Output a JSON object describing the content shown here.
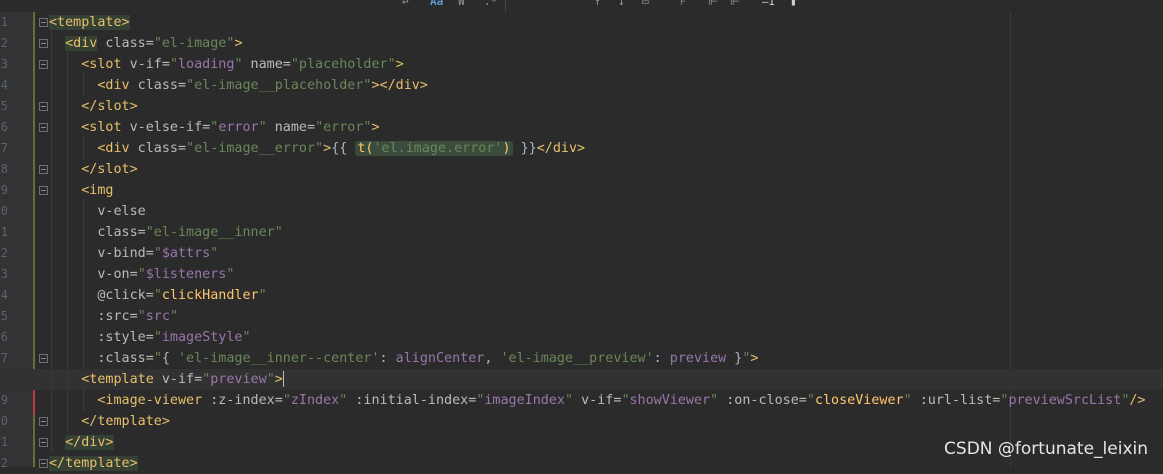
{
  "editor": {
    "language": "vue-template",
    "current_line_index": 17,
    "lines": [
      {
        "num": "1",
        "indent": 0,
        "fold": true
      },
      {
        "num": "2",
        "indent": 1,
        "fold": true
      },
      {
        "num": "3",
        "indent": 2,
        "fold": true
      },
      {
        "num": "4",
        "indent": 3,
        "fold": false
      },
      {
        "num": "5",
        "indent": 2,
        "fold": true
      },
      {
        "num": "6",
        "indent": 2,
        "fold": true
      },
      {
        "num": "7",
        "indent": 3,
        "fold": false
      },
      {
        "num": "8",
        "indent": 2,
        "fold": true
      },
      {
        "num": "9",
        "indent": 2,
        "fold": true
      },
      {
        "num": "0",
        "indent": 3,
        "fold": false
      },
      {
        "num": "1",
        "indent": 3,
        "fold": false
      },
      {
        "num": "2",
        "indent": 3,
        "fold": false
      },
      {
        "num": "3",
        "indent": 3,
        "fold": false
      },
      {
        "num": "4",
        "indent": 3,
        "fold": false
      },
      {
        "num": "5",
        "indent": 3,
        "fold": false
      },
      {
        "num": "6",
        "indent": 3,
        "fold": false
      },
      {
        "num": "7",
        "indent": 3,
        "fold": true
      },
      {
        "num": "8",
        "indent": 2,
        "fold": true
      },
      {
        "num": "9",
        "indent": 3,
        "fold": false
      },
      {
        "num": "0",
        "indent": 2,
        "fold": true
      },
      {
        "num": "1",
        "indent": 1,
        "fold": true
      },
      {
        "num": "2",
        "indent": 0,
        "fold": true
      }
    ]
  },
  "code": {
    "l1": {
      "open": "<template>"
    },
    "l2": {
      "open": "<div",
      "a1": " class=",
      "v1": "\"el-image\"",
      "close": ">"
    },
    "l3": {
      "open": "<slot",
      "a1": " v-if=",
      "v1q1": "\"",
      "v1": "loading",
      "v1q2": "\"",
      "a2": " name=",
      "v2": "\"placeholder\"",
      "close": ">"
    },
    "l4": {
      "open": "<div",
      "a1": " class=",
      "v1": "\"el-image__placeholder\"",
      "close": "></div>"
    },
    "l5": {
      "open": "</slot>"
    },
    "l6": {
      "open": "<slot",
      "a1": " v-else-if=",
      "v1q1": "\"",
      "v1": "error",
      "v1q2": "\"",
      "a2": " name=",
      "v2": "\"error\"",
      "close": ">"
    },
    "l7": {
      "open": "<div",
      "a1": " class=",
      "v1": "\"el-image__error\"",
      "gt": ">",
      "mus_open": "{{ ",
      "fn": "t(",
      "arg": "'el.image.error'",
      "fn_close": ")",
      "mus_close": " }}",
      "end": "</div>"
    },
    "l8": {
      "open": "</slot>"
    },
    "l9": {
      "open": "<img"
    },
    "l10": {
      "attr": "v-else"
    },
    "l11": {
      "attr": "class=",
      "val": "\"el-image__inner\""
    },
    "l12": {
      "attr": "v-bind=",
      "q1": "\"",
      "val": "$attrs",
      "q2": "\""
    },
    "l13": {
      "attr": "v-on=",
      "q1": "\"",
      "val": "$listeners",
      "q2": "\""
    },
    "l14": {
      "attr": "@click=",
      "q1": "\"",
      "val": "clickHandler",
      "q2": "\""
    },
    "l15": {
      "attr": ":src=",
      "q1": "\"",
      "val": "src",
      "q2": "\""
    },
    "l16": {
      "attr": ":style=",
      "q1": "\"",
      "val": "imageStyle",
      "q2": "\""
    },
    "l17": {
      "attr": ":class=",
      "q1": "\"",
      "brace_open": "{ ",
      "s1": "'el-image__inner--center'",
      "colon1": ": ",
      "v1": "alignCenter",
      "comma": ", ",
      "s2": "'el-image__preview'",
      "colon2": ": ",
      "v2": "preview",
      "brace_close": " }",
      "q2": "\"",
      "close": ">"
    },
    "l18": {
      "open": "<template",
      "a1": " v-if=",
      "q1": "\"",
      "v1": "preview",
      "q2": "\"",
      "close": ">"
    },
    "l19": {
      "open": "<image-viewer",
      "a1": " :z-index=",
      "v1": "zIndex",
      "a2": " :initial-index=",
      "v2": "imageIndex",
      "a3": " v-if=",
      "v3": "showViewer",
      "a4": " :on-close=",
      "v4": "closeViewer",
      "a5": " :url-list=",
      "v5": "previewSrcList",
      "q": "\"",
      "close": "/>"
    },
    "l20": {
      "open": "</template>"
    },
    "l21": {
      "open": "</div>"
    },
    "l22": {
      "open": "</template>"
    }
  },
  "toolbar": {
    "icons": [
      "undo-icon",
      "match-case-icon",
      "words-icon",
      "regex-icon",
      "up-arrow-icon",
      "down-arrow-icon",
      "filter-icon",
      "align-icon",
      "align-multi-icon",
      "cursor-icon",
      "settings-icon"
    ]
  },
  "watermark": {
    "text": "CSDN @fortunate_leixin"
  },
  "colors": {
    "background": "#2b2b2b",
    "tag": "#e8bf6a",
    "string": "#6a8759",
    "js_var": "#9876aa",
    "js_fn": "#ffc66d",
    "text": "#a9b7c6"
  }
}
